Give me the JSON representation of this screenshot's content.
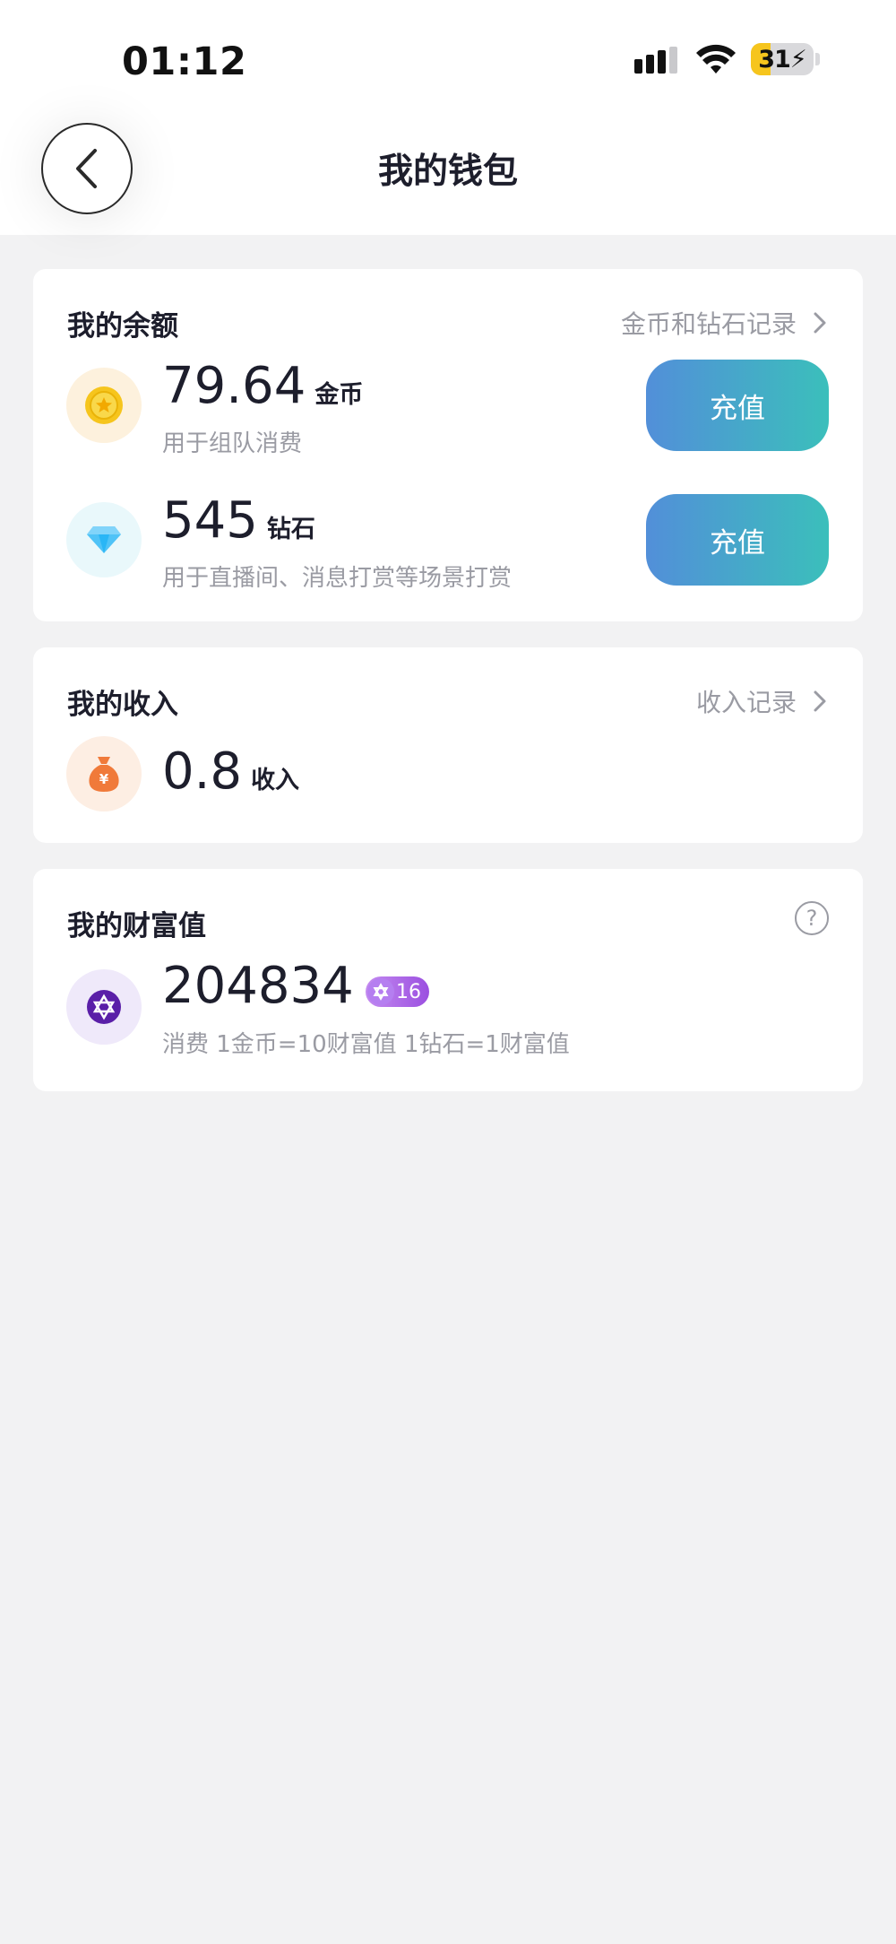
{
  "status_bar": {
    "time": "01:12",
    "battery_level": "31",
    "battery_fraction": 0.31
  },
  "header": {
    "title": "我的钱包"
  },
  "balance": {
    "title": "我的余额",
    "record_link": "金币和钻石记录",
    "coins": {
      "value": "79.64",
      "unit": "金币",
      "description": "用于组队消费",
      "button": "充值"
    },
    "diamonds": {
      "value": "545",
      "unit": "钻石",
      "description": "用于直播间、消息打赏等场景打赏",
      "button": "充值"
    }
  },
  "income": {
    "title": "我的收入",
    "record_link": "收入记录",
    "value": "0.8",
    "unit": "收入"
  },
  "wealth": {
    "title": "我的财富值",
    "value": "204834",
    "level": "16",
    "description": "消费 1金币=10财富值 1钻石=1财富值"
  },
  "colors": {
    "accent_gradient_start": "#528fd9",
    "accent_gradient_end": "#3bbfbb",
    "coin": "#f6c51d",
    "diamond": "#4fc3f7",
    "income": "#f07a3a",
    "wealth": "#5a1fa8"
  },
  "icons": {
    "coin": "coin-icon",
    "diamond": "diamond-icon",
    "income": "money-bag-icon",
    "wealth": "star-of-david-icon",
    "help": "question-mark-icon",
    "back": "chevron-left-icon",
    "link": "chevron-right-icon"
  }
}
